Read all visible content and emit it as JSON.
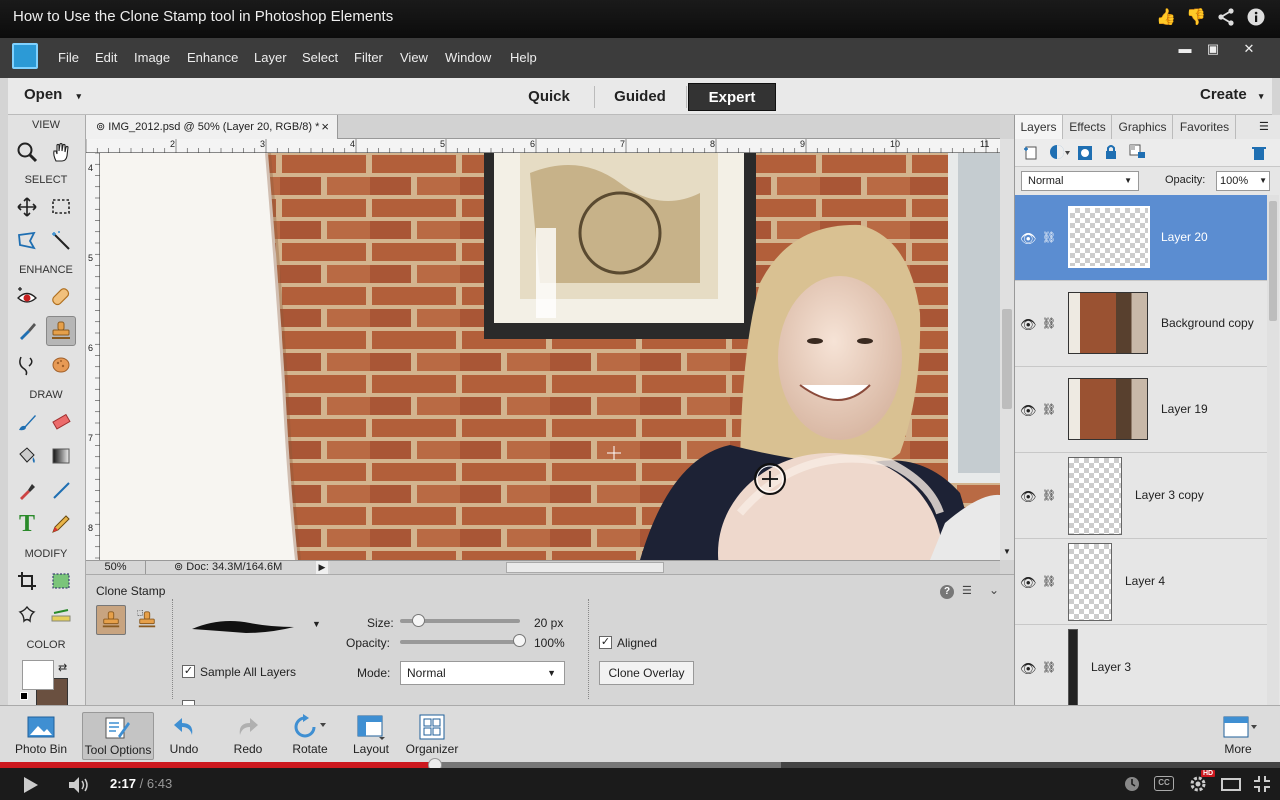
{
  "video": {
    "title": "How to Use the Clone Stamp tool in Photoshop Elements",
    "time_current": "2:17",
    "time_total": " / 6:43",
    "played_fraction": 0.34,
    "buffered_fraction": 0.61,
    "hd_badge": "HD",
    "top_icons": [
      "like-icon",
      "dislike-icon",
      "share-icon",
      "info-icon"
    ]
  },
  "menu": {
    "items": [
      "File",
      "Edit",
      "Image",
      "Enhance",
      "Layer",
      "Select",
      "Filter",
      "View",
      "Window",
      "Help"
    ],
    "window_buttons": [
      "▬",
      "▣",
      "✕"
    ]
  },
  "modebar": {
    "open_label": "Open",
    "tabs": [
      "Quick",
      "Guided",
      "Expert"
    ],
    "active_tab": "Expert",
    "create_label": "Create"
  },
  "toolbox": {
    "sections": [
      "VIEW",
      "SELECT",
      "ENHANCE",
      "DRAW",
      "MODIFY",
      "COLOR"
    ],
    "active_tool": "clone-stamp"
  },
  "document": {
    "tab_title": "⊚ IMG_2012.psd @ 50% (Layer 20, RGB/8) *",
    "close": "×",
    "zoom": "50%",
    "doc_size": "⊚ Doc: 34.3M/164.6M",
    "ruler_h": [
      "2",
      "3",
      "4",
      "5",
      "6",
      "7",
      "8",
      "9",
      "10",
      "11"
    ],
    "ruler_v": [
      "4",
      "5",
      "6",
      "7",
      "8"
    ]
  },
  "tool_options": {
    "tool_name": "Clone Stamp",
    "size_label": "Size:",
    "size_value": "20 px",
    "opacity_label": "Opacity:",
    "opacity_value": "100%",
    "mode_label": "Mode:",
    "mode_value": "Normal",
    "sample_all_layers": "Sample All Layers",
    "aligned": "Aligned",
    "clone_overlay": "Clone Overlay",
    "help": "?"
  },
  "layers_panel": {
    "tabs": [
      "Layers",
      "Effects",
      "Graphics",
      "Favorites"
    ],
    "blend_mode": "Normal",
    "opacity_label": "Opacity:",
    "opacity_value": "100%",
    "layers": [
      {
        "name": "Layer 20",
        "selected": true
      },
      {
        "name": "Background copy",
        "selected": false
      },
      {
        "name": "Layer 19",
        "selected": false
      },
      {
        "name": "Layer 3 copy",
        "selected": false
      },
      {
        "name": "Layer 4",
        "selected": false
      },
      {
        "name": "Layer 3",
        "selected": false
      }
    ]
  },
  "taskbar": {
    "items": [
      "Photo Bin",
      "Tool Options",
      "Undo",
      "Redo",
      "Rotate",
      "Layout",
      "Organizer"
    ],
    "more": "More"
  }
}
